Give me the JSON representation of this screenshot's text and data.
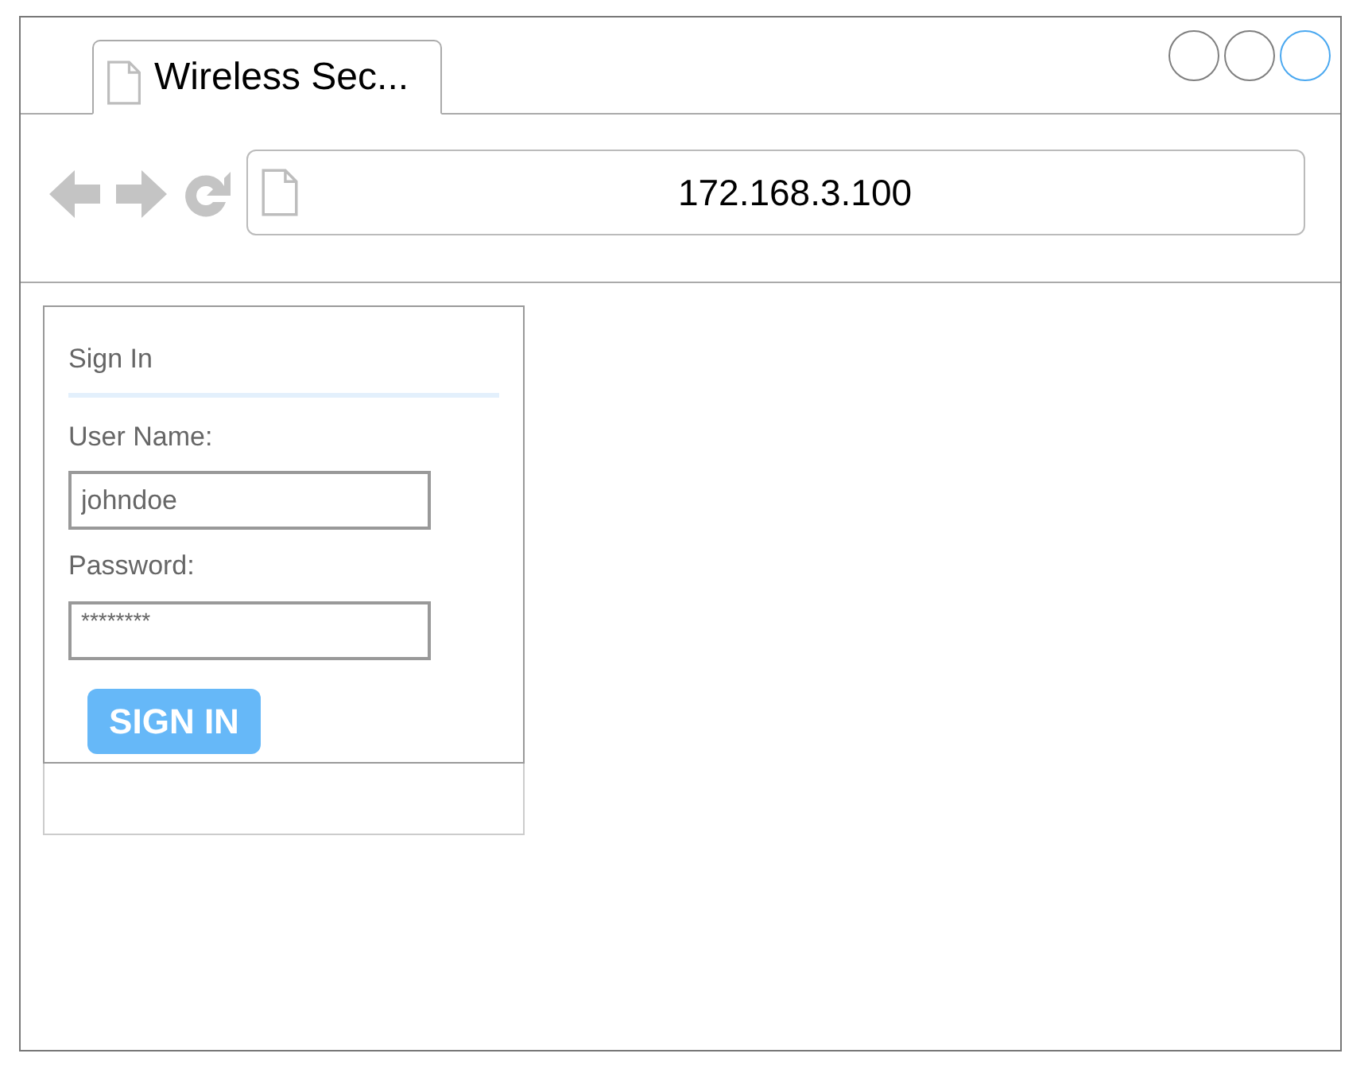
{
  "tab": {
    "title": "Wireless Sec..."
  },
  "window_controls": [
    {
      "color": "#7f7f7f"
    },
    {
      "color": "#7f7f7f"
    },
    {
      "color": "#4aa8f0"
    }
  ],
  "address_bar": {
    "value": "172.168.3.100"
  },
  "sign_in": {
    "heading": "Sign In",
    "username_label": "User Name:",
    "username": "johndoe",
    "password_label": "Password:",
    "password": "********",
    "button": "SIGN IN"
  }
}
